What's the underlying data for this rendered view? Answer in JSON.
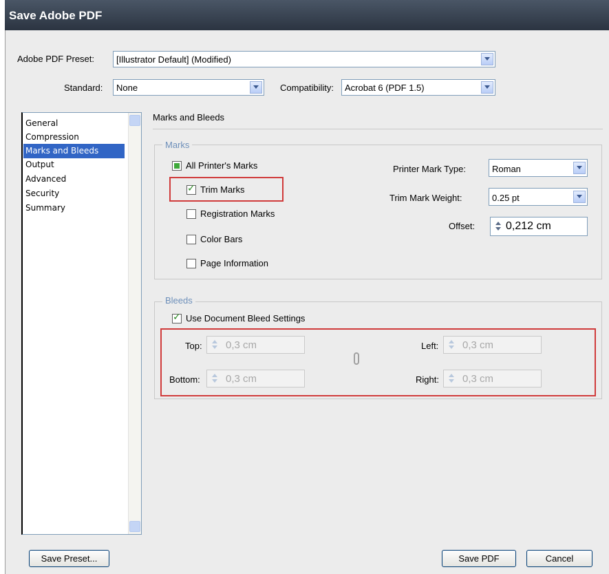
{
  "window": {
    "title": "Save Adobe PDF"
  },
  "preset": {
    "label": "Adobe PDF Preset:",
    "value": "[Illustrator Default] (Modified)"
  },
  "standard": {
    "label": "Standard:",
    "value": "None"
  },
  "compatibility": {
    "label": "Compatibility:",
    "value": "Acrobat 6 (PDF 1.5)"
  },
  "sidebar": {
    "items": [
      {
        "label": "General"
      },
      {
        "label": "Compression"
      },
      {
        "label": "Marks and Bleeds"
      },
      {
        "label": "Output"
      },
      {
        "label": "Advanced"
      },
      {
        "label": "Security"
      },
      {
        "label": "Summary"
      }
    ],
    "selected": "Marks and Bleeds"
  },
  "panel": {
    "title": "Marks and Bleeds"
  },
  "marks": {
    "group_label": "Marks",
    "all_printers_marks": "All Printer's Marks",
    "trim_marks": "Trim Marks",
    "registration_marks": "Registration Marks",
    "color_bars": "Color Bars",
    "page_information": "Page Information",
    "printer_mark_type_label": "Printer Mark Type:",
    "printer_mark_type_value": "Roman",
    "trim_mark_weight_label": "Trim Mark Weight:",
    "trim_mark_weight_value": "0.25 pt",
    "offset_label": "Offset:",
    "offset_value": "0,212 cm"
  },
  "bleeds": {
    "group_label": "Bleeds",
    "use_document_bleed": "Use Document Bleed Settings",
    "top_label": "Top:",
    "top_value": "0,3 cm",
    "bottom_label": "Bottom:",
    "bottom_value": "0,3 cm",
    "left_label": "Left:",
    "left_value": "0,3 cm",
    "right_label": "Right:",
    "right_value": "0,3 cm"
  },
  "buttons": {
    "save_preset": "Save Preset...",
    "save_pdf": "Save PDF",
    "cancel": "Cancel"
  },
  "colors": {
    "title_bar": "#2b3441",
    "selection": "#3165c5",
    "group_label": "#6d8fba",
    "highlight_box": "#d03a3a"
  }
}
